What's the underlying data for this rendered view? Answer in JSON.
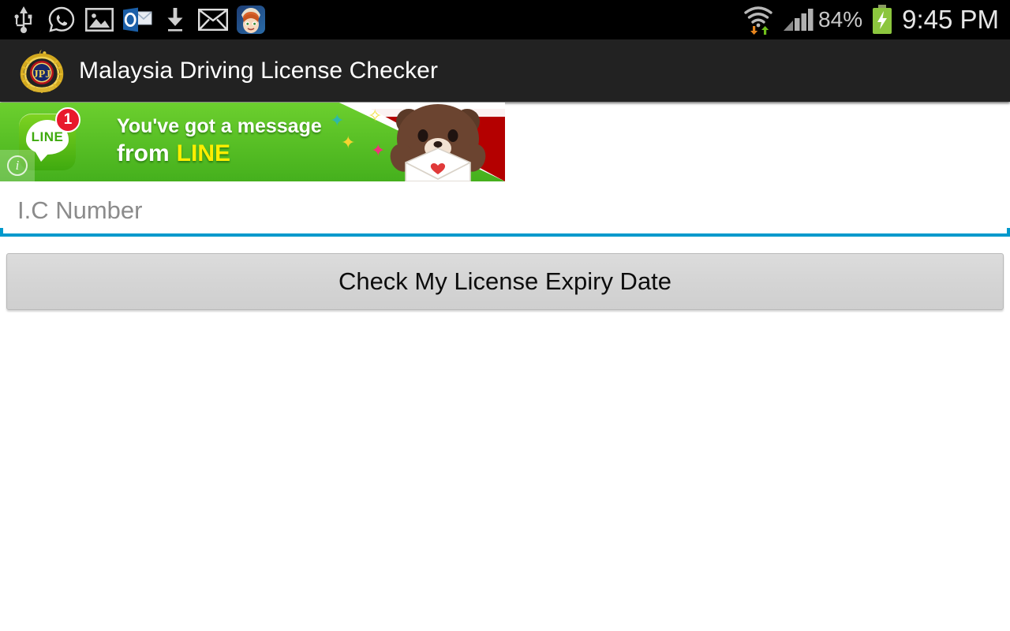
{
  "status_bar": {
    "background": "#000000",
    "left_icons": [
      {
        "name": "usb-icon",
        "label": "USB"
      },
      {
        "name": "whatsapp-icon",
        "label": "WhatsApp"
      },
      {
        "name": "gallery-icon",
        "label": "Gallery"
      },
      {
        "name": "outlook-icon",
        "label": "Outlook"
      },
      {
        "name": "download-icon",
        "label": "Download"
      },
      {
        "name": "email-icon",
        "label": "Email"
      },
      {
        "name": "game-avatar-icon",
        "label": "Game"
      }
    ],
    "wifi": {
      "name": "wifi-icon",
      "label": "Wi-Fi",
      "down_arrow_color": "#e8861e",
      "up_arrow_color": "#6fbf1a"
    },
    "signal": {
      "name": "cellular-signal-icon",
      "label": "Signal",
      "bars": 4
    },
    "battery_percent": "84%",
    "battery": {
      "name": "battery-charging-icon",
      "label": "Charging",
      "color": "#8cc63e"
    },
    "clock": "9:45 PM"
  },
  "app_bar": {
    "background": "#222222",
    "logo_name": "jpj-emblem-icon",
    "logo_label": "JPJ Malaysia Road Transport Department emblem",
    "title": "Malaysia Driving License Checker"
  },
  "ad_banner": {
    "advertiser": "LINE",
    "icon_word": "LINE",
    "badge_count": "1",
    "headline_line1": "You've got a message",
    "headline_from": "from",
    "headline_brand": "LINE",
    "character": "Brown the bear holding an envelope",
    "adchoices_label": "i",
    "colors": {
      "green": "#55c12a",
      "red": "#b40000",
      "yellow": "#ffee00"
    }
  },
  "form": {
    "ic_input_placeholder": "I.C Number",
    "ic_input_value": "",
    "underline_color": "#0099cc",
    "check_button_label": "Check My License Expiry Date"
  }
}
